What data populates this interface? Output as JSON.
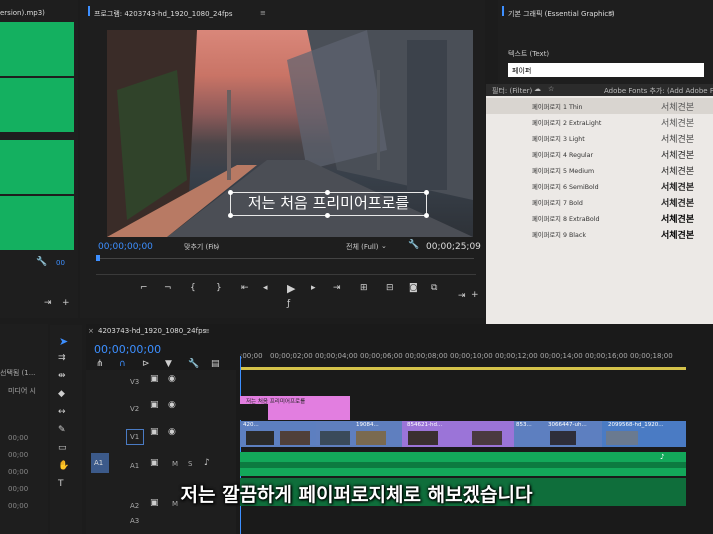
{
  "left_panel": {
    "title": "ersion).mp3)",
    "timecode": "00"
  },
  "program": {
    "title": "프로그램: 4203743-hd_1920_1080_24fps",
    "timecode_in": "00;00;00;00",
    "fit": "맞추기 (Fit)",
    "full": "전체 (Full)",
    "timecode_out": "00;00;25;09",
    "overlay_text": "저는 처음 프리미어프로를"
  },
  "essential_graphics": {
    "title": "기본 그래픽 (Essential Graphics)",
    "text_label": "텍스트 (Text)",
    "font_input_value": "페이퍼",
    "filter_label": "필터: (Filter)",
    "adobe_fonts": "Adobe Fonts 추가: (Add Adobe Fonts",
    "fonts": [
      {
        "name": "페이퍼로지 1 Thin",
        "preview": "서체견본"
      },
      {
        "name": "페이퍼로지 2 ExtraLight",
        "preview": "서체견본"
      },
      {
        "name": "페이퍼로지 3 Light",
        "preview": "서체견본"
      },
      {
        "name": "페이퍼로지 4 Regular",
        "preview": "서체견본"
      },
      {
        "name": "페이퍼로지 5 Medium",
        "preview": "서체견본"
      },
      {
        "name": "페이퍼로지 6 SemiBold",
        "preview": "서체견본"
      },
      {
        "name": "페이퍼로지 7 Bold",
        "preview": "서체견본"
      },
      {
        "name": "페이퍼로지 8 ExtraBold",
        "preview": "서체견본"
      },
      {
        "name": "페이퍼로지 9 Black",
        "preview": "서체견본"
      }
    ]
  },
  "timeline": {
    "sequence_name": "4203743-hd_1920_1080_24fps",
    "timecode": "00;00;00;00",
    "ruler": [
      ";00;00",
      "00;00;02;00",
      "00;00;04;00",
      "00;00;06;00",
      "00;00;08;00",
      "00;00;10;00",
      "00;00;12;00",
      "00;00;14;00",
      "00;00;16;00",
      "00;00;18;00"
    ],
    "tracks": [
      "V3",
      "V2",
      "V1",
      "A1",
      "A2",
      "A3"
    ],
    "source_v1": "V1",
    "source_a1": "A1",
    "v2_clip_label": "저는 처음 프리미어프로를",
    "v1_clips": [
      "420...",
      "19084...",
      "854621-hd...",
      "853...",
      "3066447-uh...",
      "2099568-hd_1920..."
    ]
  },
  "left_misc": {
    "sel_text": "선택됨 (1...",
    "media_text": "미디어 시",
    "time1": "00;00",
    "time2": "00;00",
    "time3": "00;00",
    "time4": "00;00",
    "time5": "00;00"
  },
  "subtitle": "저는 깔끔하게 페이퍼로지체로 해보겠습니다",
  "colors": {
    "accent_blue": "#3d8fff",
    "audio_green": "#14b060",
    "v1_clip": "#4a7bc4",
    "v2_clip": "#e27ee0",
    "v1_purple": "#9b74d8"
  }
}
